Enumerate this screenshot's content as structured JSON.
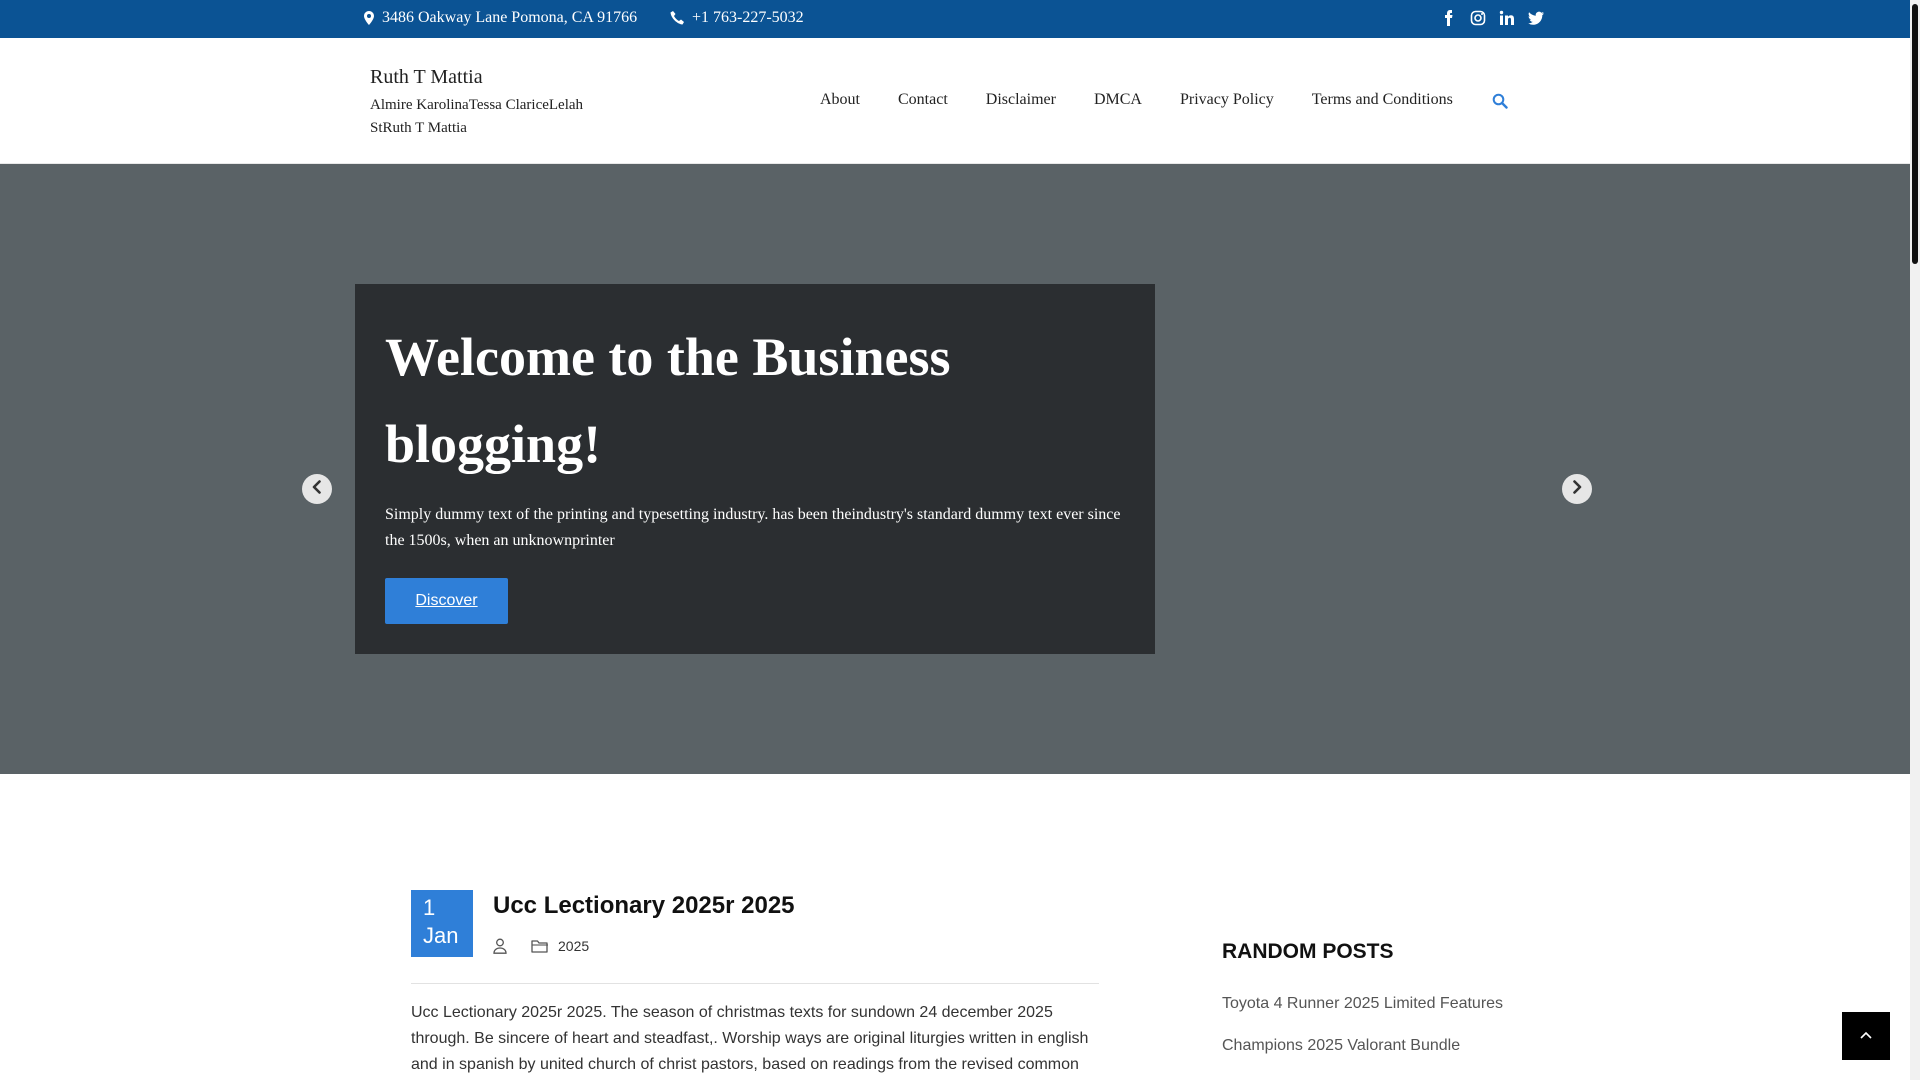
{
  "topbar": {
    "address": "3486 Oakway Lane Pomona, CA 91766",
    "phone": "+1 763-227-5032",
    "socials": [
      "facebook-icon",
      "instagram-icon",
      "linkedin-icon",
      "twitter-icon"
    ]
  },
  "header": {
    "title": "Ruth T Mattia",
    "tagline": "Almire KarolinaTessa ClariceLelah StRuth T Mattia",
    "nav": [
      "About",
      "Contact",
      "Disclaimer",
      "DMCA",
      "Privacy Policy",
      "Terms and Conditions"
    ]
  },
  "hero": {
    "title": "Welcome to the Business blogging!",
    "text": "Simply dummy text of the printing and typesetting industry. has been theindustry's standard dummy text ever since the 1500s, when an unknownprinter",
    "button": "Discover"
  },
  "post": {
    "day": "1",
    "month": "Jan",
    "title": "Ucc Lectionary 2025r 2025",
    "category": "2025",
    "excerpt": "Ucc Lectionary 2025r 2025. The season of christmas texts for sundown 24 december 2025 through. Be sincere of heart and steadfast,. Worship ways are original liturgies written in english and in spanish by united church of christ pastors, based on readings from the revised common"
  },
  "sidebar": {
    "title": "RANDOM POSTS",
    "items": [
      "Toyota 4 Runner 2025 Limited Features",
      "Champions 2025 Valorant Bundle"
    ]
  },
  "colors": {
    "topbar": "#0b5394",
    "accent": "#2f7fd8",
    "hero_bg": "#5a6266",
    "hero_box": "#2b2e31"
  }
}
